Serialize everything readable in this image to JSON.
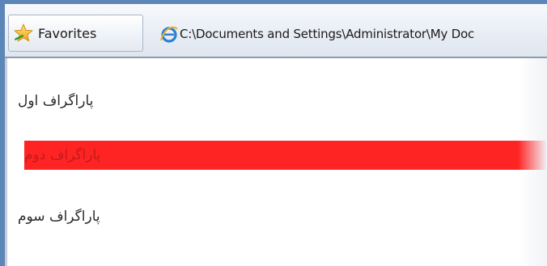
{
  "tabbar": {
    "favorites_label": "Favorites",
    "page_tab_title": "C:\\Documents and Settings\\Administrator\\My Doc"
  },
  "content": {
    "paragraphs": [
      {
        "text": "پاراگراف اول",
        "highlight": false
      },
      {
        "text": "پاراگراف دوم",
        "highlight": true,
        "background_color": "#ff2424"
      },
      {
        "text": "پاراگراف سوم",
        "highlight": false
      }
    ]
  },
  "colors": {
    "window_frame": "#5d86b8",
    "highlight_background": "#ff2424"
  },
  "icons": {
    "favorites": "star-icon",
    "page_tab": "internet-explorer-icon"
  }
}
